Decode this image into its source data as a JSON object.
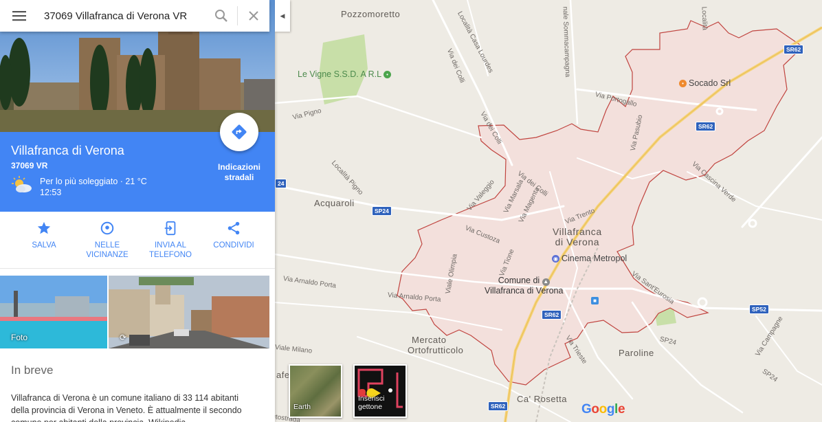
{
  "search": {
    "query": "37069 Villafranca di Verona VR"
  },
  "place": {
    "title": "Villafranca di Verona",
    "subtitle": "37069 VR",
    "weather_line1": "Per lo più soleggiato · 21 °C",
    "weather_line2": "12:53",
    "directions_label_1": "Indicazioni",
    "directions_label_2": "stradali"
  },
  "actions": [
    {
      "icon": "star-icon",
      "label_1": "SALVA",
      "label_2": ""
    },
    {
      "icon": "nearby-pin-icon",
      "label_1": "NELLE",
      "label_2": "VICINANZE"
    },
    {
      "icon": "send-to-phone-icon",
      "label_1": "INVIA AL",
      "label_2": "TELEFONO"
    },
    {
      "icon": "share-icon",
      "label_1": "CONDIVIDI",
      "label_2": ""
    }
  ],
  "photos": {
    "photo1_label": "Foto"
  },
  "brief": {
    "title": "In breve",
    "text": "Villafranca di Verona è un comune italiano di 33 114 abitanti della provincia di Verona in Veneto. È attualmente il secondo comune per abitanti della provincia. Wikipedia"
  },
  "map": {
    "places": {
      "pozzomoretto": "Pozzomoretto",
      "acquaroli": "Acquaroli",
      "mercato1": "Mercato",
      "mercato2": "Ortofrutticolo",
      "paroline": "Paroline",
      "carosetta": "Ca' Rosetta",
      "town1": "Villafranca",
      "town2": "di Verona",
      "comune1": "Comune di",
      "comune2": "Villafranca di Verona",
      "afe": "afe"
    },
    "pois": {
      "levigne": "Le Vigne S.S.D. A R.L",
      "socado": "Socado Srl",
      "cinema": "Cinema Metropol"
    },
    "streets": {
      "loc_casa_lourdes": "Località Casa Lourdes",
      "sommacampagna": "nale Sommacampagna",
      "localita_top": "Località",
      "via_dei_colli_1": "Via dei Colli",
      "via_dei_colli_2": "Via dei Colli",
      "via_dei_colli_3": "Via dei Colli",
      "via_portogallo": "Via Portogallo",
      "via_pigno": "Via Pigno",
      "localita_pigno": "Località Pigno",
      "via_pasubio": "Via Pasubio",
      "via_cascina_verde": "Via Cascina Verde",
      "via_valeggio": "Via Valeggio",
      "via_marsala": "Via Marsala",
      "via_magenta": "Via Magenta",
      "via_custoza": "Via Custoza",
      "via_trento": "Via Trento",
      "via_olimpia": "Viale Olimpia",
      "via_tione": "Via Tione",
      "via_arnaldo_1": "Via Arnaldo Porta",
      "via_arnaldo_2": "Via Arnaldo Porta",
      "via_santeurosia": "Via Sant'Eurosia",
      "via_milano": "Viale Milano",
      "via_trieste": "Via Trieste",
      "via_campagne": "Via Campagne",
      "autostrada": "autostrada",
      "sp24_a": "SP24",
      "sp24_b": "SP24"
    },
    "shields": {
      "sr62_a": "SR62",
      "sr62_b": "SR62",
      "sr62_c": "SR62",
      "sr62_d": "SR62",
      "sp24": "SP24",
      "sp52": "SP52",
      "left24": "24"
    },
    "tiles": {
      "earth": "Earth",
      "pacman_1": "Inserisci",
      "pacman_2": "gettone"
    },
    "logo": [
      "G",
      "o",
      "o",
      "g",
      "l",
      "e"
    ]
  },
  "colors": {
    "accent": "#4285f4",
    "boundary": "#c0443f",
    "town_fill": "#f4dcd9",
    "highway": "#f6d37a"
  }
}
